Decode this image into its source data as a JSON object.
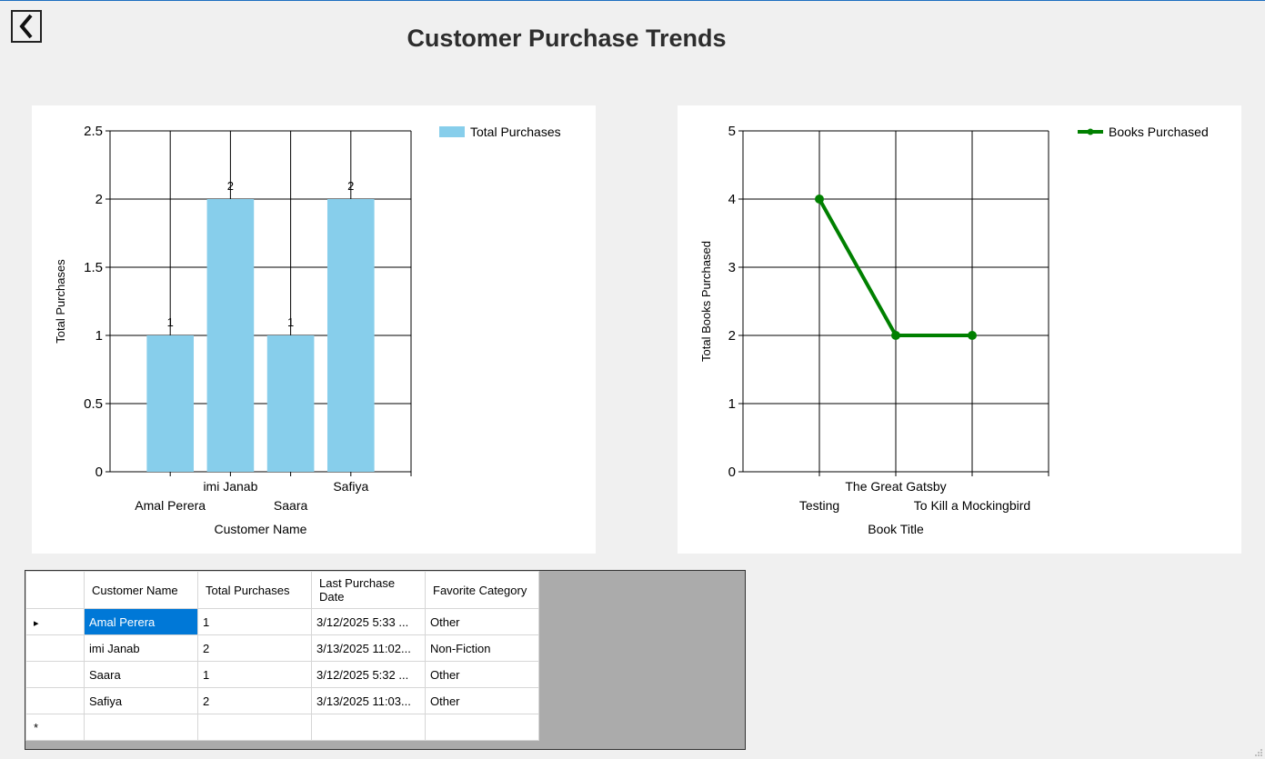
{
  "window": {
    "title": "Customer Purchase Trends",
    "back_icon": "chevron-left-icon"
  },
  "charts": {
    "left_legend": "Total Purchases",
    "right_legend": "Books Purchased"
  },
  "chart_data": [
    {
      "type": "bar",
      "categories": [
        "Amal Perera",
        "imi Janab",
        "Saara",
        "Safiya"
      ],
      "values": [
        1,
        2,
        1,
        2
      ],
      "data_labels": [
        "1",
        "2",
        "1",
        "2"
      ],
      "series": [
        {
          "name": "Total Purchases",
          "values": [
            1,
            2,
            1,
            2
          ]
        }
      ],
      "xlabel": "Customer Name",
      "ylabel": "Total Purchases",
      "ylim": [
        0,
        2.5
      ],
      "yticks": [
        "0",
        "0.5",
        "1",
        "1.5",
        "2",
        "2.5"
      ],
      "grid": true,
      "legend": "top-right",
      "color": "#87ceeb"
    },
    {
      "type": "line",
      "categories": [
        "Testing",
        "The Great Gatsby",
        "To Kill a Mockingbird"
      ],
      "values": [
        4,
        2,
        2
      ],
      "series": [
        {
          "name": "Books Purchased",
          "values": [
            4,
            2,
            2
          ]
        }
      ],
      "xlabel": "Book Title",
      "ylabel": "Total Books Purchased",
      "ylim": [
        0,
        5
      ],
      "yticks": [
        "0",
        "1",
        "2",
        "3",
        "4",
        "5"
      ],
      "grid": true,
      "legend": "top-right",
      "color": "#008000"
    }
  ],
  "grid": {
    "columns": [
      "Customer Name",
      "Total Purchases",
      "Last Purchase Date",
      "Favorite Category"
    ],
    "rows": [
      {
        "name": "Amal Perera",
        "total": "1",
        "date": "3/12/2025 5:33 ...",
        "category": "Other"
      },
      {
        "name": "imi Janab",
        "total": "2",
        "date": "3/13/2025 11:02...",
        "category": "Non-Fiction"
      },
      {
        "name": "Saara",
        "total": "1",
        "date": "3/12/2025 5:32 ...",
        "category": "Other"
      },
      {
        "name": "Safiya",
        "total": "2",
        "date": "3/13/2025 11:03...",
        "category": "Other"
      }
    ],
    "selected_row": 0,
    "new_row_marker": "*",
    "current_row_marker": "▸"
  },
  "colors": {
    "selection": "#0078d7",
    "grid_background": "#ababab",
    "bar": "#87ceeb",
    "line": "#008000"
  }
}
